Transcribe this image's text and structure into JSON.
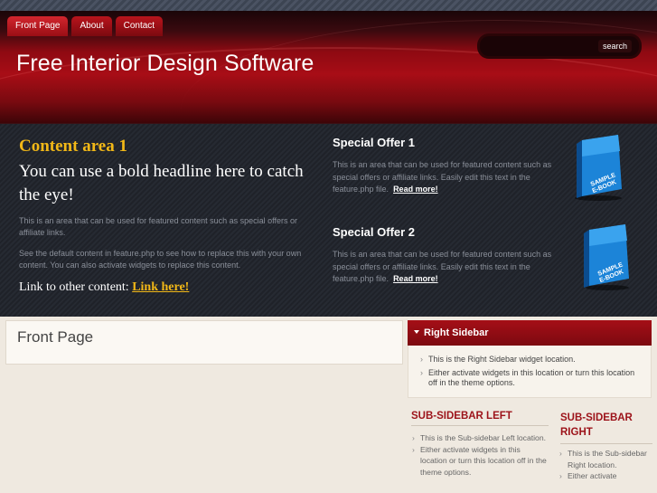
{
  "nav": {
    "tabs": [
      {
        "label": "Front Page",
        "active": true
      },
      {
        "label": "About"
      },
      {
        "label": "Contact"
      }
    ]
  },
  "search": {
    "placeholder": "",
    "button": "search"
  },
  "site": {
    "title": "Free Interior Design Software"
  },
  "feature": {
    "heading": "Content area 1",
    "headline": "You can use a bold headline here to catch the eye!",
    "para1": "This is an area that can be used for featured content such as special offers or affiliate links.",
    "para2": "See the default content in feature.php to see how to replace this with your own content. You can also activate widgets to replace this content.",
    "link_prefix": "Link to other content:",
    "link_text": "Link here!"
  },
  "offers": [
    {
      "title": "Special Offer 1",
      "text": "This is an area that can be used for featured content such as special offers or affiliate links. Easily edit this text in the feature.php file.",
      "more": "Read more!",
      "ebook_label_1": "SAMPLE",
      "ebook_label_2": "E-BOOK"
    },
    {
      "title": "Special Offer 2",
      "text": "This is an area that can be used for featured content such as special offers or affiliate links. Easily edit this text in the feature.php file.",
      "more": "Read more!",
      "ebook_label_1": "SAMPLE",
      "ebook_label_2": "E-BOOK"
    }
  ],
  "main": {
    "title": "Front Page"
  },
  "right_sidebar": {
    "title": "Right Sidebar",
    "items": [
      "This is the Right Sidebar widget location.",
      "Either activate widgets in this location or turn this location off in the theme options."
    ]
  },
  "sub_left": {
    "title": "SUB-SIDEBAR LEFT",
    "items": [
      "This is the Sub-sidebar Left location.",
      "Either activate widgets in this location or turn this location off in the theme options."
    ]
  },
  "sub_right": {
    "title": "SUB-SIDEBAR RIGHT",
    "items": [
      "This is the Sub-sidebar Right location.",
      "Either activate"
    ]
  },
  "colors": {
    "brand_red": "#a80d16",
    "accent_gold": "#f2b817",
    "feature_bg": "#23262d"
  }
}
